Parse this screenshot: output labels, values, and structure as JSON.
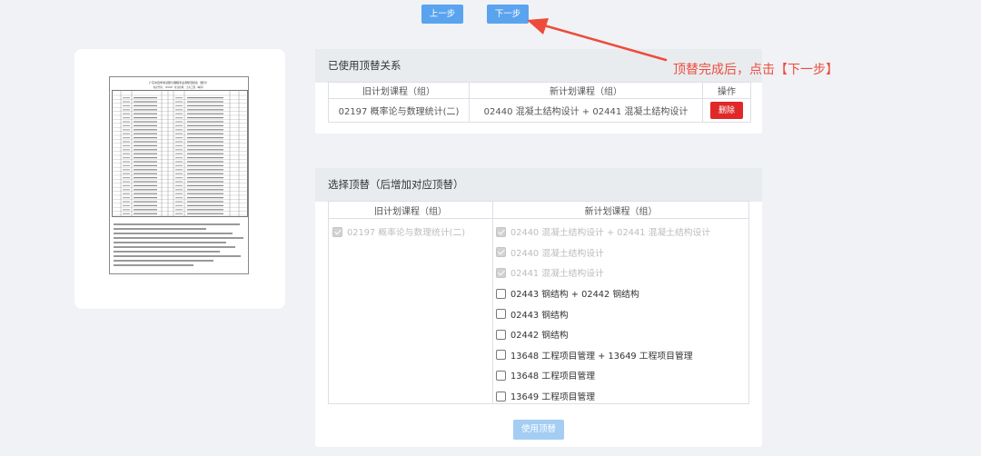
{
  "nav": {
    "prev_label": "上一步",
    "next_label": "下一步"
  },
  "preview": {
    "doc_title": "广东省自学考试部分课程专业调整顶替表（部分）",
    "doc_subtitle": "专业代码：（2020）专业名称：土木工程（本科）"
  },
  "used_panel": {
    "title": "已使用顶替关系",
    "columns": {
      "old": "旧计划课程（组）",
      "new": "新计划课程（组）",
      "action": "操作"
    },
    "rows": [
      {
        "old": "02197 概率论与数理统计(二)",
        "new": "02440 混凝土结构设计 + 02441 混凝土结构设计",
        "action": "删除"
      }
    ]
  },
  "select_panel": {
    "title": "选择顶替（后增加对应顶替）",
    "columns": {
      "old": "旧计划课程（组）",
      "new": "新计划课程（组）"
    },
    "old_options": [
      {
        "label": "02197 概率论与数理统计(二)",
        "checked": true,
        "disabled": true
      }
    ],
    "new_options": [
      {
        "label": "02440 混凝土结构设计 + 02441 混凝土结构设计",
        "checked": true,
        "disabled": true
      },
      {
        "label": "02440 混凝土结构设计",
        "checked": true,
        "disabled": true
      },
      {
        "label": "02441 混凝土结构设计",
        "checked": true,
        "disabled": true
      },
      {
        "label": "02443 钢结构 + 02442 钢结构",
        "checked": false,
        "disabled": false
      },
      {
        "label": "02443 钢结构",
        "checked": false,
        "disabled": false
      },
      {
        "label": "02442 钢结构",
        "checked": false,
        "disabled": false
      },
      {
        "label": "13648 工程项目管理 + 13649 工程项目管理",
        "checked": false,
        "disabled": false
      },
      {
        "label": "13648 工程项目管理",
        "checked": false,
        "disabled": false
      },
      {
        "label": "13649 工程项目管理",
        "checked": false,
        "disabled": false
      }
    ],
    "submit_label": "使用顶替"
  },
  "annotation": {
    "text": "顶替完成后，点击【下一步】",
    "color": "#ee4b3c"
  },
  "colors": {
    "primary": "#5aa3ef",
    "danger": "#e02828",
    "disabled_primary": "#a4cdf4"
  }
}
